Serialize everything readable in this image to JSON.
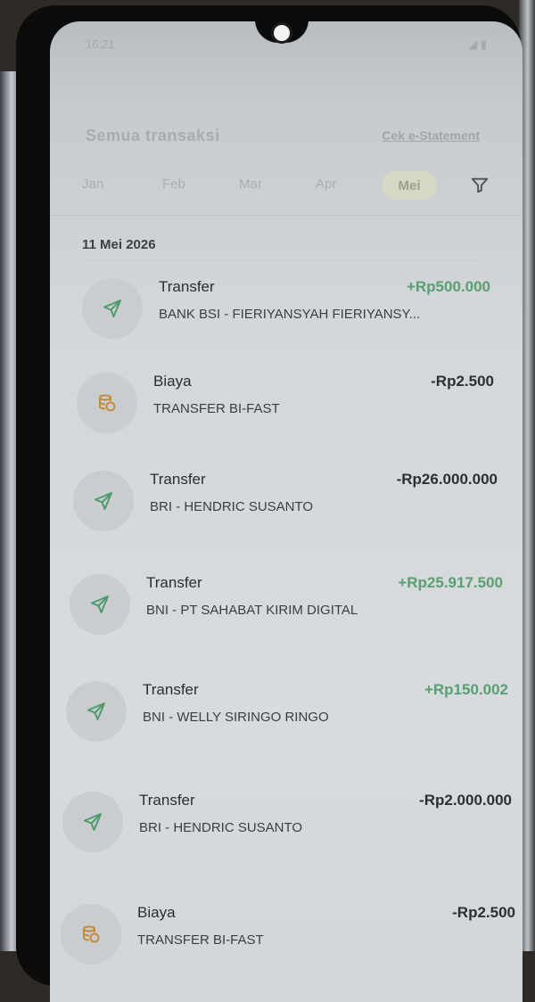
{
  "status_bar": {
    "time": "16:21",
    "icons": "◢ ▮"
  },
  "header": {
    "title": "Semua transaksi",
    "statement_link": "Cek e-Statement"
  },
  "months": [
    "Jan",
    "Feb",
    "Mar",
    "Apr",
    "Mei"
  ],
  "active_month": "Mei",
  "date_group": "11 Mei 2026",
  "transactions": [
    {
      "label": "Transfer",
      "desc": "BANK BSI - FIERIYANSYAH FIERIYANSY...",
      "amount": "+Rp500.000",
      "icon": "send-icon",
      "type": "credit"
    },
    {
      "label": "Biaya",
      "desc": "TRANSFER BI-FAST",
      "amount": "-Rp2.500",
      "icon": "coins-icon",
      "type": "debit"
    },
    {
      "label": "Transfer",
      "desc": "BRI - HENDRIC SUSANTO",
      "amount": "-Rp26.000.000",
      "icon": "send-icon",
      "type": "debit"
    },
    {
      "label": "Transfer",
      "desc": "BNI - PT SAHABAT KIRIM DIGITAL",
      "amount": "+Rp25.917.500",
      "icon": "send-icon",
      "type": "credit"
    },
    {
      "label": "Transfer",
      "desc": "BNI - WELLY SIRINGO RINGO",
      "amount": "+Rp150.002",
      "icon": "send-icon",
      "type": "credit"
    },
    {
      "label": "Transfer",
      "desc": "BRI - HENDRIC SUSANTO",
      "amount": "-Rp2.000.000",
      "icon": "send-icon",
      "type": "debit"
    },
    {
      "label": "Biaya",
      "desc": "TRANSFER BI-FAST",
      "amount": "-Rp2.500",
      "icon": "coins-icon",
      "type": "debit"
    }
  ],
  "colors": {
    "positive": "#5a9e72",
    "negative": "#2d3033",
    "accent_icon": "#4f9a6c",
    "coin_icon": "#c48a3a"
  }
}
